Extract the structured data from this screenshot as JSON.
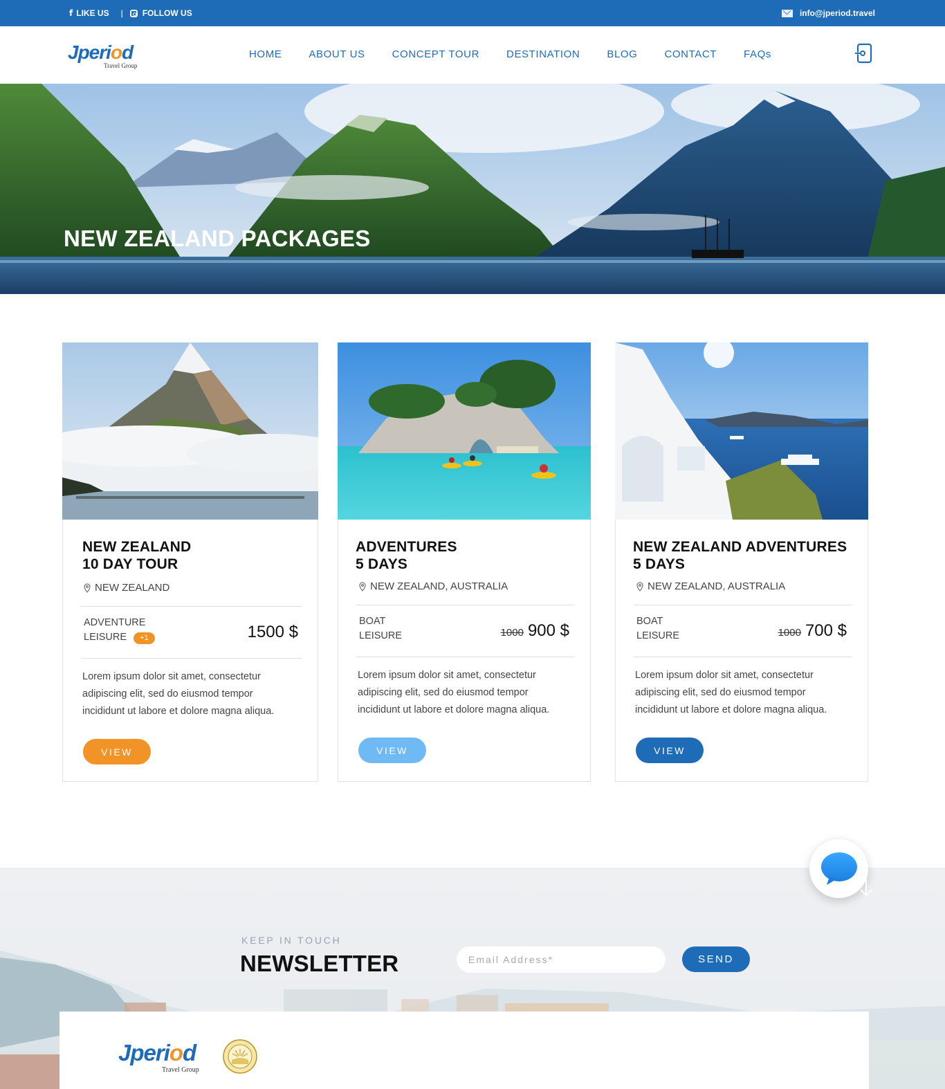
{
  "topbar": {
    "like_label": "LIKE US",
    "separator": "|",
    "follow_label": "FOLLOW US",
    "email": "info@jperiod.travel"
  },
  "brand": {
    "name_a": "Jperi",
    "name_o": "o",
    "name_b": "d",
    "tagline": "Travel Group"
  },
  "nav": {
    "items": [
      "HOME",
      "ABOUT US",
      "CONCEPT TOUR",
      "DESTINATION",
      "BLOG",
      "CONTACT",
      "FAQs"
    ]
  },
  "hero": {
    "title": "NEW ZEALAND PACKAGES"
  },
  "cards": [
    {
      "title_line1": "NEW ZEALAND",
      "title_line2": "10 DAY TOUR",
      "location": "NEW ZEALAND",
      "tag1": "ADVENTURE",
      "tag2": "LEISURE",
      "badge": "+1",
      "old_price": "",
      "price": "1500 $",
      "description": "Lorem ipsum dolor sit amet, consectetur adipiscing elit, sed do eiusmod tempor incididunt ut labore et dolore magna aliqua.",
      "button": "VIEW",
      "button_color": "#f29327"
    },
    {
      "title_line1": "ADVENTURES",
      "title_line2": "5 DAYS",
      "location": "NEW ZEALAND, AUSTRALIA",
      "tag1": "BOAT",
      "tag2": "LEISURE",
      "old_price": "1000",
      "price": "900 $",
      "description": "Lorem ipsum dolor sit amet, consectetur adipiscing elit, sed do eiusmod tempor incididunt ut labore et dolore magna aliqua.",
      "button": "VIEW",
      "button_color": "#6fbaf5"
    },
    {
      "title_line1": "NEW ZEALAND ADVENTURES",
      "title_line2": "5 DAYS",
      "location": "NEW ZEALAND, AUSTRALIA",
      "tag1": "BOAT",
      "tag2": "LEISURE",
      "old_price": "1000",
      "price": "700 $",
      "description": "Lorem ipsum dolor sit amet, consectetur adipiscing elit, sed do eiusmod tempor incididunt ut labore et dolore magna aliqua.",
      "button": "VIEW",
      "button_color": "#1e6bb8"
    }
  ],
  "newsletter": {
    "kicker": "KEEP IN TOUCH",
    "title": "NEWSLETTER",
    "email_placeholder": "Email Address*",
    "send_label": "SEND"
  },
  "icons": {
    "facebook": "facebook-icon",
    "instagram": "instagram-icon",
    "mail": "mail-icon",
    "login": "login-icon",
    "location": "location-pin-icon",
    "chat": "chat-bubble-icon",
    "scroll": "arrow-down-icon"
  },
  "colors": {
    "brand_blue": "#1e6bb8",
    "accent_orange": "#f29327",
    "light_blue": "#6fbaf5"
  }
}
